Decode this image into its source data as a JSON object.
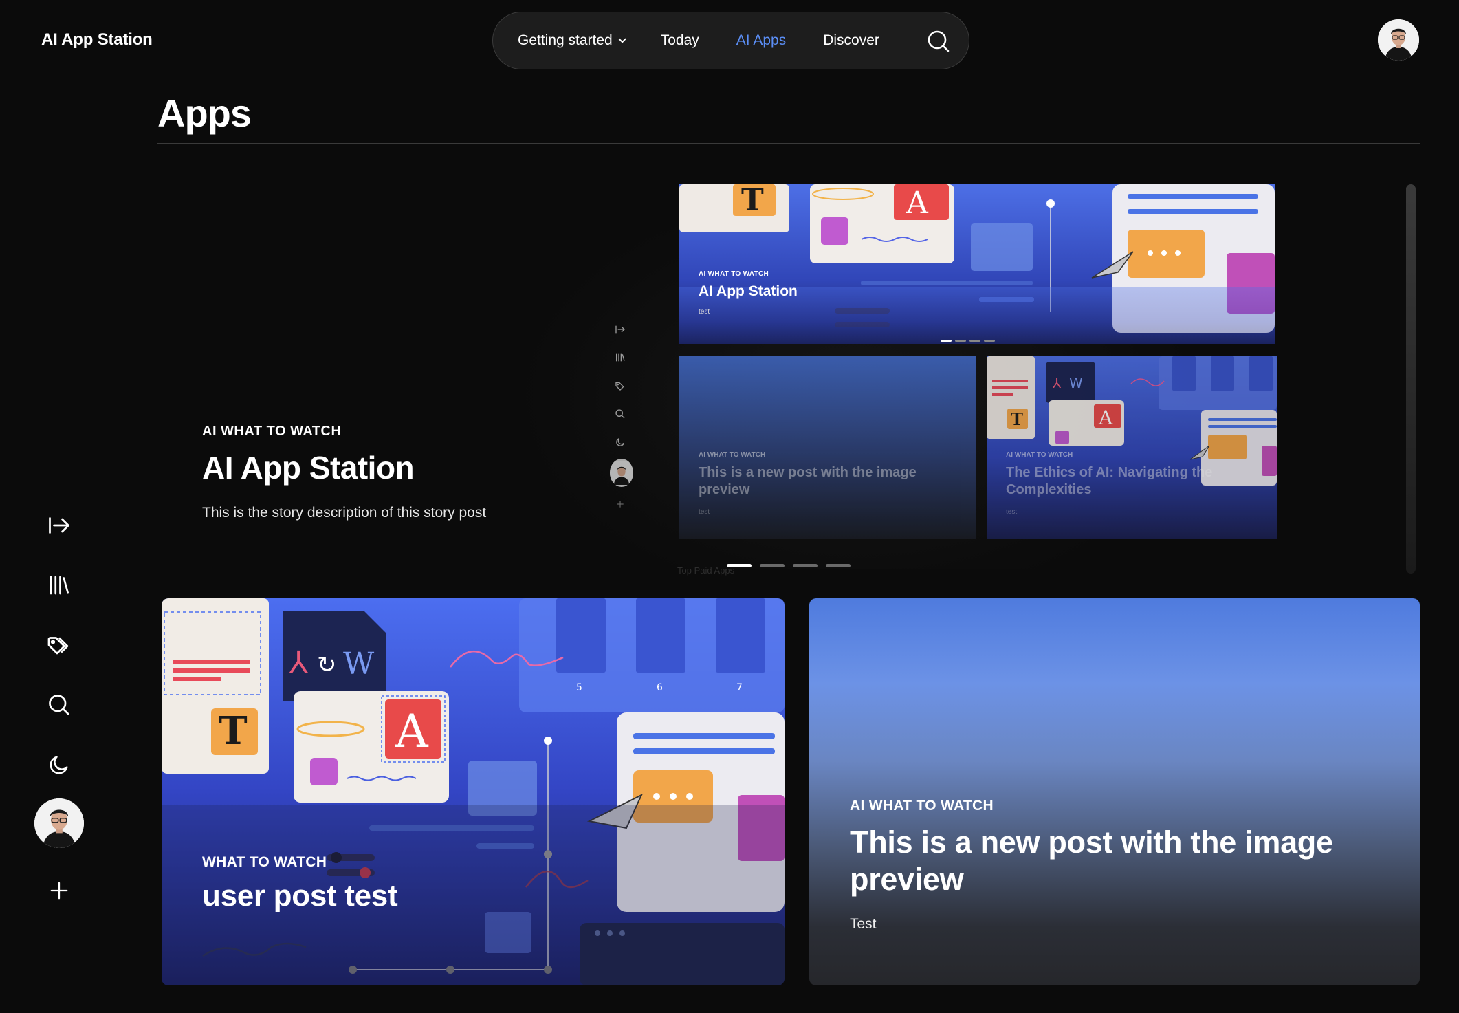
{
  "app": {
    "brand": "AI App Station"
  },
  "topnav": {
    "items": [
      {
        "label": "Getting started",
        "has_dropdown": true,
        "active": false
      },
      {
        "label": "Today",
        "active": false
      },
      {
        "label": "AI Apps",
        "active": true
      },
      {
        "label": "Discover",
        "active": false
      }
    ],
    "search_icon": "search-icon"
  },
  "page": {
    "title": "Apps"
  },
  "sidebar": {
    "items": [
      "collapse-sidebar-icon",
      "library-icon",
      "tags-icon",
      "search-icon",
      "dark-mode-moon-icon",
      "user-avatar",
      "plus-icon"
    ]
  },
  "hero": {
    "kicker": "AI WHAT TO WATCH",
    "title": "AI App Station",
    "description": "This is the story description of this story post",
    "slide_count": 4,
    "active_slide": 1
  },
  "preview": {
    "main": {
      "kicker": "AI WHAT TO WATCH",
      "title": "AI App Station",
      "desc": "test"
    },
    "card1": {
      "kicker": "AI WHAT TO WATCH",
      "title": "This is a new post with the image preview",
      "desc": "test"
    },
    "card2": {
      "kicker": "AI WHAT TO WATCH",
      "title": "The Ethics of AI: Navigating the Complexities",
      "desc": "test"
    },
    "footer": "Top Paid Apps"
  },
  "cards": [
    {
      "kicker": "WHAT TO WATCH",
      "title": "user post test"
    },
    {
      "kicker": "AI WHAT TO WATCH",
      "title": "This is a new post with the image preview",
      "desc": "Test"
    }
  ],
  "illustration": {
    "tile_numbers": [
      "5",
      "6",
      "7"
    ],
    "letters": [
      "T",
      "A",
      "W"
    ]
  },
  "colors": {
    "accent": "#5b8ef5",
    "background": "#0b0b0b",
    "nav_bg": "#1d1d1d"
  }
}
